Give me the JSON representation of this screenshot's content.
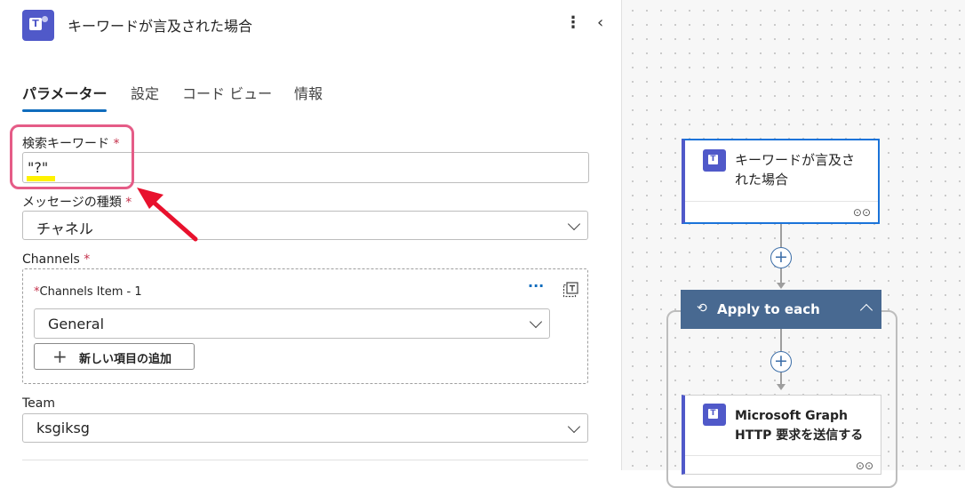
{
  "header": {
    "title": "キーワードが言及された場合",
    "more_icon": "⋮",
    "collapse_icon": "‹"
  },
  "tabs": [
    {
      "label": "パラメーター",
      "active": true
    },
    {
      "label": "設定"
    },
    {
      "label": "コード ビュー"
    },
    {
      "label": "情報"
    }
  ],
  "fields": {
    "keyword": {
      "label": "検索キーワード",
      "required": "*",
      "value": "\"?\""
    },
    "message_type": {
      "label": "メッセージの種類",
      "required": "*",
      "value": "チャネル"
    },
    "channels": {
      "label": "Channels",
      "required": "*",
      "item_label": "Channels Item - 1",
      "item_required": "*",
      "item_value": "General",
      "more_icon": "···",
      "add_button_icon": "+",
      "add_button_label": "新しい項目の追加"
    },
    "team": {
      "label": "Team",
      "value": "ksgiksg"
    }
  },
  "canvas": {
    "trigger_card": {
      "title": "キーワードが言及された場合",
      "title_line1": "キーワードが言及さ",
      "title_line2": "れた場合",
      "icon": "teams-icon"
    },
    "add_step_symbol": "+",
    "apply_each": {
      "label": "Apply to each",
      "loop_icon": "⟲"
    },
    "graph_card": {
      "title_line1": "Microsoft Graph",
      "title_line2": "HTTP 要求を送信する",
      "icon": "teams-icon"
    },
    "link_icon": "⊙⊙"
  },
  "colors": {
    "accent": "#0f6cbd",
    "teams": "#5059c9",
    "apply_header": "#486991",
    "highlight": "#e55c87",
    "arrow": "#e8112d"
  }
}
